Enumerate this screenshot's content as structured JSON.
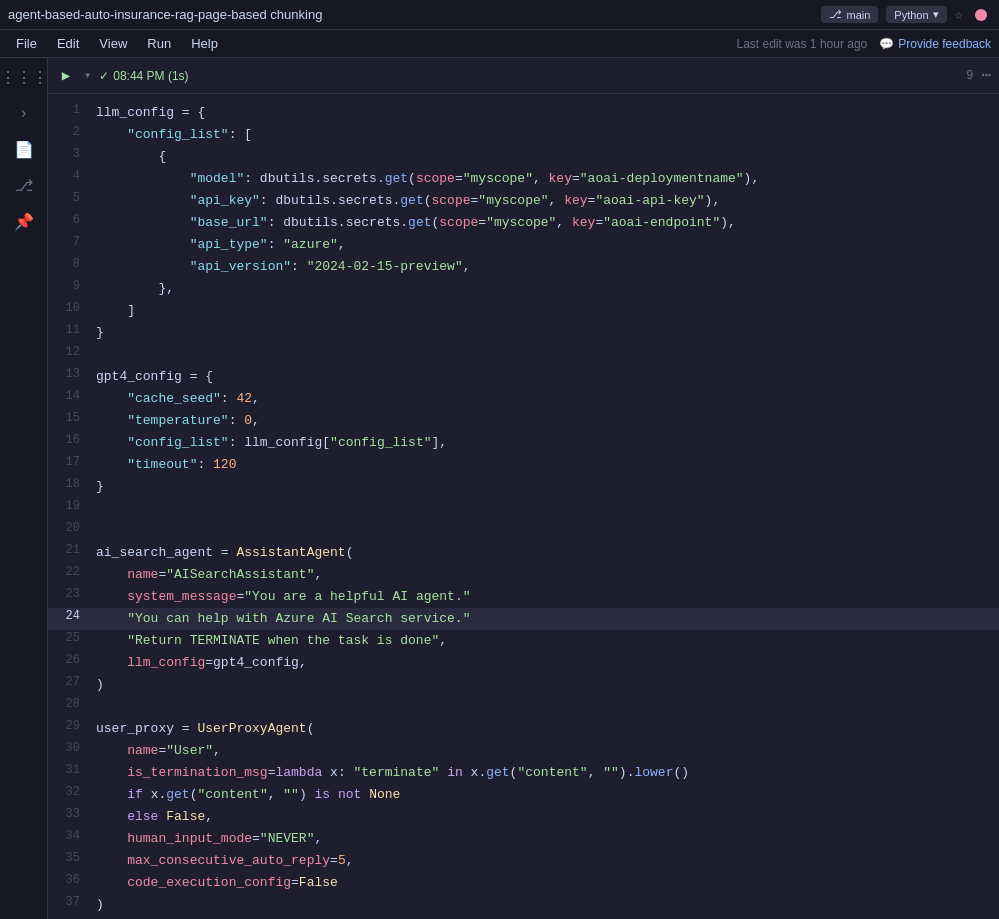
{
  "titlebar": {
    "title": "agent-based-auto-insurance-rag-page-based chunking",
    "branch": "⎇ main",
    "language": "Python",
    "language_chevron": "▾",
    "star": "☆"
  },
  "menubar": {
    "file": "File",
    "edit": "Edit",
    "view": "View",
    "run": "Run",
    "help": "Help",
    "last_edit": "Last edit was 1 hour ago",
    "feedback": "Provide feedback"
  },
  "cell": {
    "status_time": "08:44 PM (1s)",
    "execution_count": "9"
  },
  "lines": [
    {
      "num": 1,
      "content": "llm_config = {"
    },
    {
      "num": 2,
      "content": "    \"config_list\": ["
    },
    {
      "num": 3,
      "content": "        {"
    },
    {
      "num": 4,
      "content": "            \"model\": dbutils.secrets.get(scope=\"myscope\", key=\"aoai-deploymentname\"),"
    },
    {
      "num": 5,
      "content": "            \"api_key\": dbutils.secrets.get(scope=\"myscope\", key=\"aoai-api-key\"),"
    },
    {
      "num": 6,
      "content": "            \"base_url\": dbutils.secrets.get(scope=\"myscope\", key=\"aoai-endpoint\"),"
    },
    {
      "num": 7,
      "content": "            \"api_type\": \"azure\","
    },
    {
      "num": 8,
      "content": "            \"api_version\": \"2024-02-15-preview\","
    },
    {
      "num": 9,
      "content": "        },"
    },
    {
      "num": 10,
      "content": "    ]"
    },
    {
      "num": 11,
      "content": "}"
    },
    {
      "num": 12,
      "content": ""
    },
    {
      "num": 13,
      "content": "gpt4_config = {"
    },
    {
      "num": 14,
      "content": "    \"cache_seed\": 42,"
    },
    {
      "num": 15,
      "content": "    \"temperature\": 0,"
    },
    {
      "num": 16,
      "content": "    \"config_list\": llm_config[\"config_list\"],"
    },
    {
      "num": 17,
      "content": "    \"timeout\": 120"
    },
    {
      "num": 18,
      "content": "}"
    },
    {
      "num": 19,
      "content": ""
    },
    {
      "num": 20,
      "content": ""
    },
    {
      "num": 21,
      "content": "ai_search_agent = AssistantAgent("
    },
    {
      "num": 22,
      "content": "    name=\"AISearchAssistant\","
    },
    {
      "num": 23,
      "content": "    system_message=\"You are a helpful AI agent.\""
    },
    {
      "num": 24,
      "content": "    \"You can help with Azure AI Search service.\""
    },
    {
      "num": 25,
      "content": "    \"Return TERMINATE when the task is done\","
    },
    {
      "num": 26,
      "content": "    llm_config=gpt4_config,"
    },
    {
      "num": 27,
      "content": ")"
    },
    {
      "num": 28,
      "content": ""
    },
    {
      "num": 29,
      "content": "user_proxy = UserProxyAgent("
    },
    {
      "num": 30,
      "content": "    name=\"User\","
    },
    {
      "num": 31,
      "content": "    is_termination_msg=lambda x: \"terminate\" in x.get(\"content\", \"\").lower()"
    },
    {
      "num": 32,
      "content": "    if x.get(\"content\", \"\") is not None"
    },
    {
      "num": 33,
      "content": "    else False,"
    },
    {
      "num": 34,
      "content": "    human_input_mode=\"NEVER\","
    },
    {
      "num": 35,
      "content": "    max_consecutive_auto_reply=5,"
    },
    {
      "num": 36,
      "content": "    code_execution_config=False"
    },
    {
      "num": 37,
      "content": ")"
    }
  ]
}
